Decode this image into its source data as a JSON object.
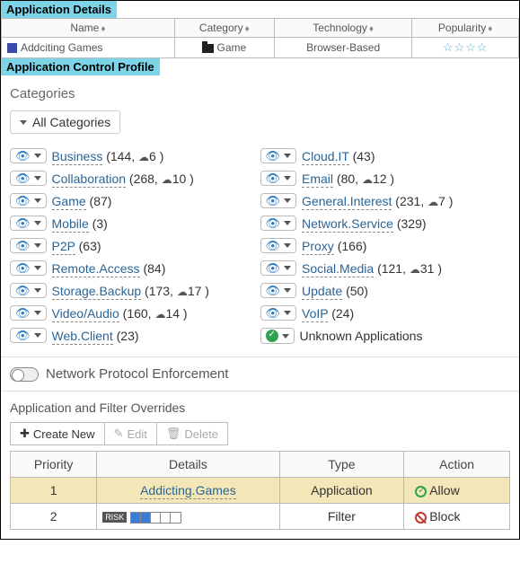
{
  "appDetails": {
    "header": "Application Details",
    "columns": {
      "name": "Name",
      "category": "Category",
      "technology": "Technology",
      "popularity": "Popularity"
    },
    "row": {
      "name": "Addciting Games",
      "category": "Game",
      "technology": "Browser-Based",
      "popularityStars": "☆☆☆☆"
    }
  },
  "profileHeader": "Application Control Profile",
  "categories": {
    "title": "Categories",
    "allLabel": "All Categories",
    "left": [
      {
        "name": "Business",
        "count": 144,
        "cloud": 6
      },
      {
        "name": "Collaboration",
        "count": 268,
        "cloud": 10
      },
      {
        "name": "Game",
        "count": 87
      },
      {
        "name": "Mobile",
        "count": 3
      },
      {
        "name": "P2P",
        "count": 63
      },
      {
        "name": "Remote.Access",
        "count": 84
      },
      {
        "name": "Storage.Backup",
        "count": 173,
        "cloud": 17
      },
      {
        "name": "Video/Audio",
        "count": 160,
        "cloud": 14
      },
      {
        "name": "Web.Client",
        "count": 23
      }
    ],
    "right": [
      {
        "name": "Cloud.IT",
        "count": 43
      },
      {
        "name": "Email",
        "count": 80,
        "cloud": 12
      },
      {
        "name": "General.Interest",
        "count": 231,
        "cloud": 7
      },
      {
        "name": "Network.Service",
        "count": 329
      },
      {
        "name": "Proxy",
        "count": 166
      },
      {
        "name": "Social.Media",
        "count": 121,
        "cloud": 31
      },
      {
        "name": "Update",
        "count": 50
      },
      {
        "name": "VoIP",
        "count": 24
      },
      {
        "name": "Unknown Applications",
        "special": true
      }
    ]
  },
  "npeLabel": "Network Protocol Enforcement",
  "overrides": {
    "title": "Application and Filter Overrides",
    "createNew": "Create New",
    "edit": "Edit",
    "delete": "Delete",
    "columns": {
      "priority": "Priority",
      "details": "Details",
      "type": "Type",
      "action": "Action"
    },
    "rows": [
      {
        "priority": 1,
        "details": "Addicting.Games",
        "type": "Application",
        "action": "Allow",
        "highlight": true
      },
      {
        "priority": 2,
        "detailsRisk": true,
        "riskLabel": "RISK",
        "type": "Filter",
        "action": "Block"
      }
    ]
  }
}
